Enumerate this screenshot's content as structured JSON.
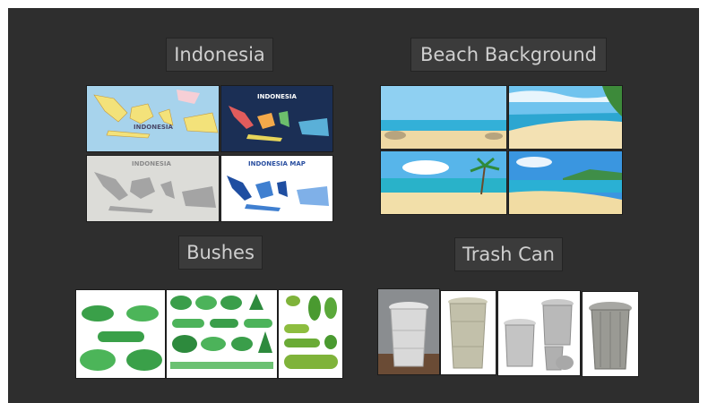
{
  "groups": {
    "indonesia": {
      "label": "Indonesia",
      "thumb_titles": [
        "INDONESIA",
        "INDONESIA",
        "INDONESIA MAP"
      ]
    },
    "beach": {
      "label": "Beach Background"
    },
    "bushes": {
      "label": "Bushes"
    },
    "trash": {
      "label": "Trash Can"
    }
  },
  "colors": {
    "panel": "#2e2e2e",
    "label_bg": "#3b3b3b",
    "label_text": "#cfcfcf"
  }
}
